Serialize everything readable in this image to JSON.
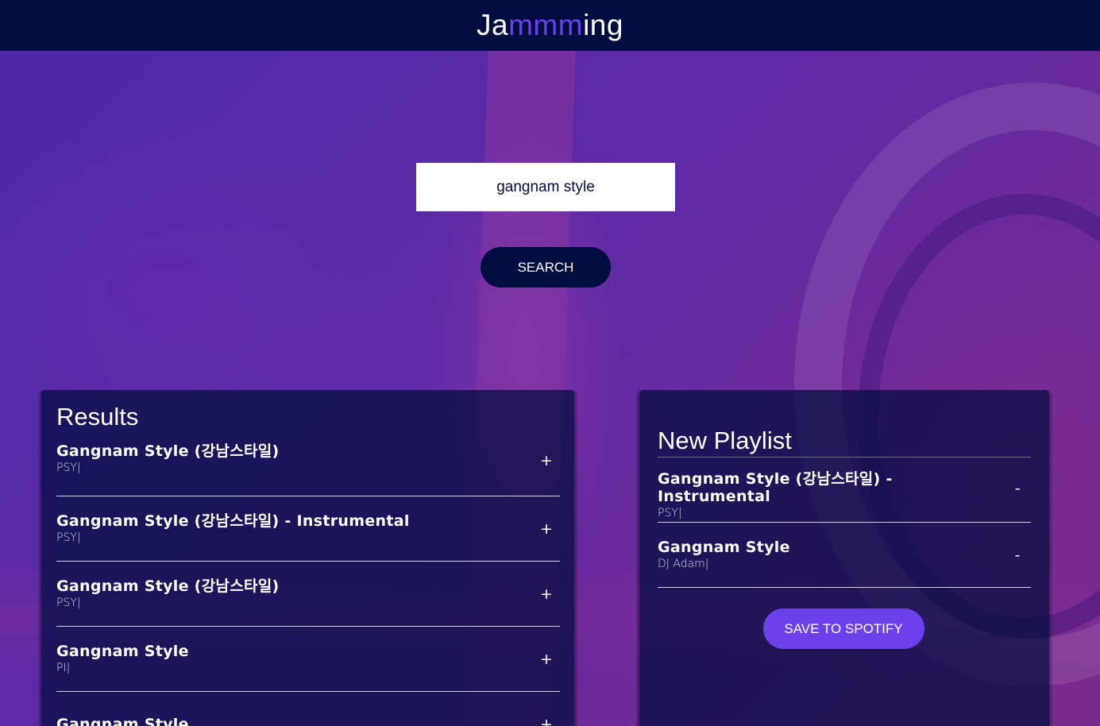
{
  "app": {
    "title_part1": "Ja",
    "title_highlight": "mmm",
    "title_part2": "ing"
  },
  "search": {
    "value": "gangnam style",
    "button_label": "SEARCH"
  },
  "results": {
    "title": "Results",
    "tracks": [
      {
        "name": "Gangnam Style (강남스타일)",
        "artist": "PSY|",
        "action": "+"
      },
      {
        "name": "Gangnam Style (강남스타일) - Instrumental",
        "artist": "PSY|",
        "action": "+"
      },
      {
        "name": "Gangnam Style (강남스타일)",
        "artist": "PSY|",
        "action": "+"
      },
      {
        "name": "Gangnam Style",
        "artist": "PI|",
        "action": "+"
      },
      {
        "name": "Gangnam Style",
        "artist": "",
        "action": "+"
      }
    ]
  },
  "playlist": {
    "title": "New Playlist",
    "tracks": [
      {
        "name": "Gangnam Style (강남스타일) - Instrumental",
        "artist": "PSY|",
        "action": "-"
      },
      {
        "name": "Gangnam Style",
        "artist": "DJ Adam|",
        "action": "-"
      }
    ],
    "save_label": "SAVE TO SPOTIFY"
  },
  "colors": {
    "header_bg": "#010c3f",
    "accent": "#6c41ec"
  }
}
